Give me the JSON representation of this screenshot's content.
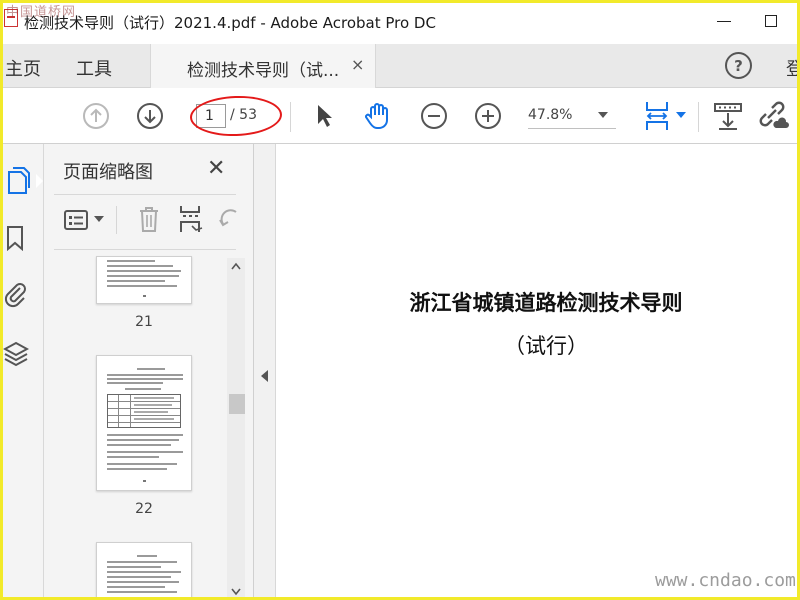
{
  "watermark_top": "中国道桥网",
  "titlebar": {
    "title": "检测技术导则（试行）2021.4.pdf - Adobe Acrobat Pro DC"
  },
  "tabs": {
    "home": "主页",
    "tools": "工具",
    "document": "检测技术导则（试...",
    "close": "×",
    "signin_partial": "登"
  },
  "toolbar": {
    "current_page": "1",
    "total_pages": "/ 53",
    "zoom": "47.8%"
  },
  "thumbnail_panel": {
    "title": "页面缩略图",
    "close": "✕",
    "pages": [
      "21",
      "22"
    ]
  },
  "document": {
    "title": "浙江省城镇道路检测技术导则",
    "subtitle": "（试行）"
  },
  "watermark_bottom": "www.cndao.com",
  "colors": {
    "accent_blue": "#1473e6",
    "highlight_red": "#e41a1a",
    "frame_yellow": "#f2ea2a"
  }
}
